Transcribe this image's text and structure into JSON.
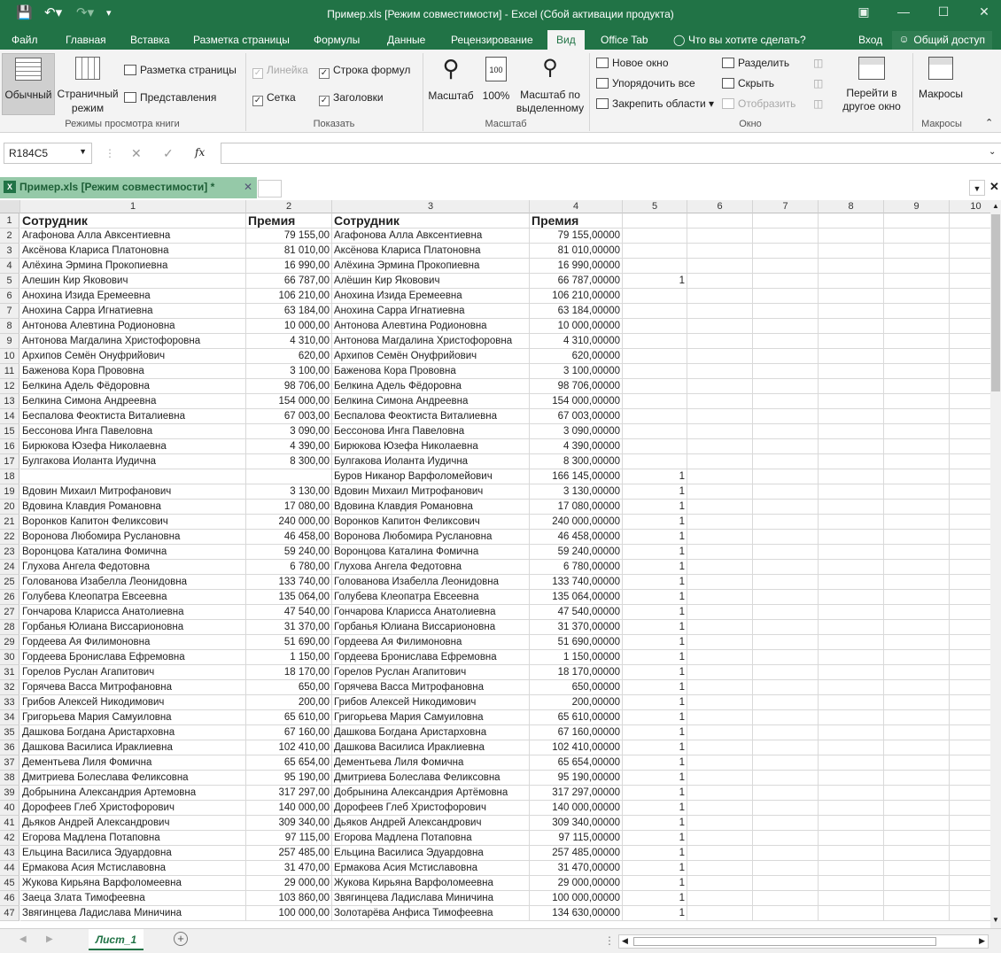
{
  "window": {
    "title": "Пример.xls  [Режим совместимости] - Excel (Сбой активации продукта)"
  },
  "menu": {
    "tabs": [
      "Файл",
      "Главная",
      "Вставка",
      "Разметка страницы",
      "Формулы",
      "Данные",
      "Рецензирование",
      "Вид",
      "Office Tab"
    ],
    "tell_me": "Что вы хотите сделать?",
    "signin": "Вход",
    "share": "Общий доступ"
  },
  "ribbon": {
    "views": {
      "normal": "Обычный",
      "page_break": "Страничный режим",
      "page_layout": "Разметка страницы",
      "custom": "Представления",
      "label": "Режимы просмотра книги"
    },
    "show": {
      "ruler": "Линейка",
      "formula_bar": "Строка формул",
      "gridlines": "Сетка",
      "headings": "Заголовки",
      "label": "Показать"
    },
    "zoom": {
      "zoom": "Масштаб",
      "zoom100": "100%",
      "selection": "Масштаб по выделенному",
      "label": "Масштаб"
    },
    "window": {
      "new": "Новое окно",
      "arrange": "Упорядочить все",
      "freeze": "Закрепить области",
      "split": "Разделить",
      "hide": "Скрыть",
      "unhide": "Отобразить",
      "switch": "Перейти в другое окно",
      "label": "Окно"
    },
    "macros": {
      "macros": "Макросы",
      "label": "Макросы"
    }
  },
  "formula": {
    "namebox": "R184C5",
    "fx": "fx",
    "content": ""
  },
  "doc_tab": {
    "name": "Пример.xls  [Режим совместимости] *"
  },
  "columns": [
    "1",
    "2",
    "3",
    "4",
    "5",
    "6",
    "7",
    "8",
    "9",
    "10"
  ],
  "rows": [
    [
      "Сотрудник",
      "Премия",
      "Сотрудник",
      "Премия",
      ""
    ],
    [
      "Агафонова Алла Авксентиевна",
      "79 155,00",
      "Агафонова Алла Авксентиевна",
      "79 155,00000",
      ""
    ],
    [
      "Аксёнова Клариса Платоновна",
      "81 010,00",
      "Аксёнова Клариса Платоновна",
      "81 010,00000",
      ""
    ],
    [
      "Алёхина Эрмина Прокопиевна",
      "16 990,00",
      "Алёхина Эрмина Прокопиевна",
      "16 990,00000",
      ""
    ],
    [
      "Алешин Кир Яковович",
      "66 787,00",
      "Алёшин Кир Яковович",
      "66 787,00000",
      "1"
    ],
    [
      "Анохина Изида Еремеевна",
      "106 210,00",
      "Анохина Изида Еремеевна",
      "106 210,00000",
      ""
    ],
    [
      "Анохина Сарра Игнатиевна",
      "63 184,00",
      "Анохина Сарра Игнатиевна",
      "63 184,00000",
      ""
    ],
    [
      "Антонова Алевтина Родионовна",
      "10 000,00",
      "Антонова Алевтина Родионовна",
      "10 000,00000",
      ""
    ],
    [
      "Антонова Магдалина Христофоровна",
      "4 310,00",
      "Антонова Магдалина Христофоровна",
      "4 310,00000",
      ""
    ],
    [
      "Архипов Семён Онуфрийович",
      "620,00",
      "Архипов Семён Онуфрийович",
      "620,00000",
      ""
    ],
    [
      "Баженова Кора Прововна",
      "3 100,00",
      "Баженова Кора Прововна",
      "3 100,00000",
      ""
    ],
    [
      "Белкина Адель Фёдоровна",
      "98 706,00",
      "Белкина Адель Фёдоровна",
      "98 706,00000",
      ""
    ],
    [
      "Белкина Симона Андреевна",
      "154 000,00",
      "Белкина Симона Андреевна",
      "154 000,00000",
      ""
    ],
    [
      "Беспалова Феоктиста Виталиевна",
      "67 003,00",
      "Беспалова Феоктиста Виталиевна",
      "67 003,00000",
      ""
    ],
    [
      "Бессонова Инга Павеловна",
      "3 090,00",
      "Бессонова Инга Павеловна",
      "3 090,00000",
      ""
    ],
    [
      "Бирюкова Юзефа Николаевна",
      "4 390,00",
      "Бирюкова Юзефа Николаевна",
      "4 390,00000",
      ""
    ],
    [
      "Булгакова Иоланта Иудична",
      "8 300,00",
      "Булгакова Иоланта Иудична",
      "8 300,00000",
      ""
    ],
    [
      "",
      "",
      "Буров Никанор Варфоломейович",
      "166 145,00000",
      "1"
    ],
    [
      "Вдовин Михаил Митрофанович",
      "3 130,00",
      "Вдовин Михаил Митрофанович",
      "3 130,00000",
      "1"
    ],
    [
      "Вдовина Клавдия Романовна",
      "17 080,00",
      "Вдовина Клавдия Романовна",
      "17 080,00000",
      "1"
    ],
    [
      "Воронков Капитон Феликсович",
      "240 000,00",
      "Воронков Капитон Феликсович",
      "240 000,00000",
      "1"
    ],
    [
      "Воронова Любомира Руслановна",
      "46 458,00",
      "Воронова Любомира Руслановна",
      "46 458,00000",
      "1"
    ],
    [
      "Воронцова Каталина Фомична",
      "59 240,00",
      "Воронцова Каталина Фомична",
      "59 240,00000",
      "1"
    ],
    [
      "Глухова Ангела Федотовна",
      "6 780,00",
      "Глухова Ангела Федотовна",
      "6 780,00000",
      "1"
    ],
    [
      "Голованова Изабелла Леонидовна",
      "133 740,00",
      "Голованова Изабелла Леонидовна",
      "133 740,00000",
      "1"
    ],
    [
      "Голубева Клеопатра Евсеевна",
      "135 064,00",
      "Голубева Клеопатра Евсеевна",
      "135 064,00000",
      "1"
    ],
    [
      "Гончарова Кларисса Анатолиевна",
      "47 540,00",
      "Гончарова Кларисса Анатолиевна",
      "47 540,00000",
      "1"
    ],
    [
      "Горбанья Юлиана Виссарионовна",
      "31 370,00",
      "Горбанья Юлиана Виссарионовна",
      "31 370,00000",
      "1"
    ],
    [
      "Гордеева Ая Филимоновна",
      "51 690,00",
      "Гордеева Ая Филимоновна",
      "51 690,00000",
      "1"
    ],
    [
      "Гордеева Бронислава Ефремовна",
      "1 150,00",
      "Гордеева Бронислава Ефремовна",
      "1 150,00000",
      "1"
    ],
    [
      "Горелов Руслан Агапитович",
      "18 170,00",
      "Горелов Руслан Агапитович",
      "18 170,00000",
      "1"
    ],
    [
      "Горячева Васса Митрофановна",
      "650,00",
      "Горячева Васса Митрофановна",
      "650,00000",
      "1"
    ],
    [
      "Грибов Алексей Никодимович",
      "200,00",
      "Грибов Алексей Никодимович",
      "200,00000",
      "1"
    ],
    [
      "Григорьева Мария Самуиловна",
      "65 610,00",
      "Григорьева Мария Самуиловна",
      "65 610,00000",
      "1"
    ],
    [
      "Дашкова Богдана Аристарховна",
      "67 160,00",
      "Дашкова Богдана Аристарховна",
      "67 160,00000",
      "1"
    ],
    [
      "Дашкова Василиса Ираклиевна",
      "102 410,00",
      "Дашкова Василиса Ираклиевна",
      "102 410,00000",
      "1"
    ],
    [
      "Дементьева Лиля Фомична",
      "65 654,00",
      "Дементьева Лиля Фомична",
      "65 654,00000",
      "1"
    ],
    [
      "Дмитриева Болеслава Феликсовна",
      "95 190,00",
      "Дмитриева Болеслава Феликсовна",
      "95 190,00000",
      "1"
    ],
    [
      "Добрынина Александрия Артемовна",
      "317 297,00",
      "Добрынина Александрия Артёмовна",
      "317 297,00000",
      "1"
    ],
    [
      "Дорофеев Глеб Христофорович",
      "140 000,00",
      "Дорофеев Глеб Христофорович",
      "140 000,00000",
      "1"
    ],
    [
      "Дьяков Андрей Александрович",
      "309 340,00",
      "Дьяков Андрей Александрович",
      "309 340,00000",
      "1"
    ],
    [
      "Егорова Мадлена Потаповна",
      "97 115,00",
      "Егорова Мадлена Потаповна",
      "97 115,00000",
      "1"
    ],
    [
      "Ельцина Василиса Эдуардовна",
      "257 485,00",
      "Ельцина Василиса Эдуардовна",
      "257 485,00000",
      "1"
    ],
    [
      "Ермакова Асия Мстиславовна",
      "31 470,00",
      "Ермакова Асия Мстиславовна",
      "31 470,00000",
      "1"
    ],
    [
      "Жукова Кирьяна Варфоломеевна",
      "29 000,00",
      "Жукова Кирьяна Варфоломеевна",
      "29 000,00000",
      "1"
    ],
    [
      "Заеца Злата Тимофеевна",
      "103 860,00",
      "Звягинцева Ладислава Миничина",
      "100 000,00000",
      "1"
    ],
    [
      "Звягинцева Ладислава Миничина",
      "100 000,00",
      "Золотарёва Анфиса Тимофеевна",
      "134 630,00000",
      "1"
    ]
  ],
  "sheet": {
    "name": "Лист_1"
  }
}
